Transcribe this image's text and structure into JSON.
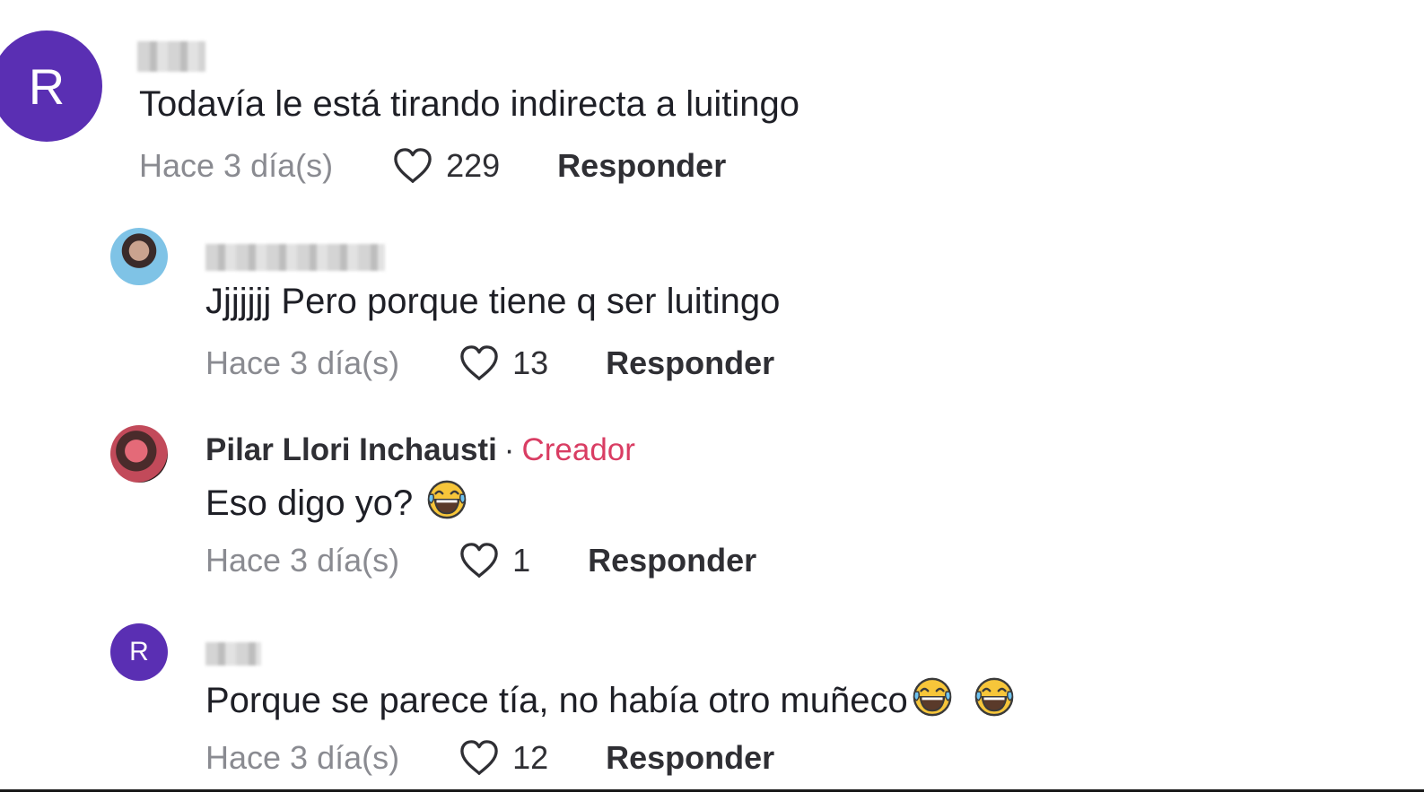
{
  "comments": [
    {
      "avatar_letter": "R",
      "avatar_color": "#5a2fb3",
      "text": "Todavía le está tirando indirecta a luitingo",
      "time": "Hace 3 día(s)",
      "likes": "229",
      "reply_label": "Responder"
    },
    {
      "text": "Jjjjjjj Pero porque tiene q ser luitingo",
      "time": "Hace 3 día(s)",
      "likes": "13",
      "reply_label": "Responder"
    },
    {
      "username": "Pilar Llori Inchausti",
      "separator": "·",
      "creator_badge": "Creador",
      "text": "Eso digo yo?",
      "emoji": "tears-of-joy-emoji",
      "time": "Hace 3 día(s)",
      "likes": "1",
      "reply_label": "Responder"
    },
    {
      "avatar_letter": "R",
      "avatar_color": "#5a2fb3",
      "text": "Porque se parece tía, no había otro muñeco",
      "emoji": "tears-of-joy-emoji",
      "time": "Hace 3 día(s)",
      "likes": "12",
      "reply_label": "Responder"
    }
  ],
  "colors": {
    "creator_badge": "#d93d63",
    "timestamp": "#8a8b91",
    "avatar_purple": "#5a2fb3"
  }
}
